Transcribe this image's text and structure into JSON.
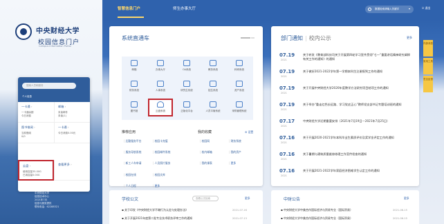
{
  "header": {
    "nav": [
      "智慧信息门户",
      "师生办事大厅"
    ],
    "search_placeholder": "数据检索请输入关键字",
    "logout": "退出"
  },
  "left": {
    "university_name": "中央财经大学",
    "portal_name": "校园信息门户",
    "portal_en": "Campus Information Portal",
    "search_placeholder": "搜索人员和服务",
    "personal_info": "个人信息",
    "cells": [
      {
        "title": "一卡通",
        "lines": [
          "一卡通余额",
          "今日消费"
        ]
      },
      {
        "title": "邮箱",
        "lines": [
          "未读邮件",
          "未读(1)"
        ]
      },
      {
        "title": "图书借阅",
        "lines": [
          "当前借阅",
          "0/0"
        ]
      },
      {
        "title": "一卡通",
        "lines": [
          "今日消费0.00元"
        ]
      },
      {
        "title": "云盘",
        "lines": [
          "使用容量35.00G",
          "已用容量0.00G"
        ]
      },
      {
        "title": "查看更多",
        "lines": []
      }
    ],
    "footer": [
      "中央财经大学",
      "信息技术中心",
      "2021年7月",
      "信息与服务提供",
      "联系电话：62288321"
    ]
  },
  "system": {
    "title": "系统直通车",
    "tiles": [
      [
        "邮箱",
        "办事大厅",
        "OA系统",
        "教务系统",
        "科研系统"
      ],
      [
        "财务系统",
        "人事系统",
        "研究生系统",
        "招生系统",
        "资产系统"
      ],
      [
        "图书馆",
        "云盘系统",
        "正版化平台",
        "人员平衡系统",
        "采购管理系统"
      ]
    ],
    "recommend_title": "推荐应用",
    "recommend_items": [
      "后勤服务平台",
      "校园卡充值",
      "服务导航系统",
      "校园邮件系统",
      "新工人车申请",
      "人员照片服务",
      "校园在线",
      "校园文库",
      "个人日程",
      "更多"
    ],
    "favorites_title": "我的收藏",
    "favorites_action": "设置",
    "favorites_items": [
      "校园网",
      "财务系统",
      "校内邮箱",
      "我的资产",
      "我的课表",
      "更多"
    ]
  },
  "notice": {
    "title_a": "部门通知",
    "title_b": "校内公示",
    "more": "更多",
    "items": [
      {
        "date": "07.19",
        "year": "2021",
        "text": "关于转发《教育部科技司关于开展第四轮学习宣传贯彻“七一”重要讲话精神研究阐释有关工作的通知》的通知"
      },
      {
        "date": "07.19",
        "year": "2021",
        "text": "关于做好2021-2022学年第一学期本科生注册报到工作的通知"
      },
      {
        "date": "07.19",
        "year": "2021",
        "text": "关于开展中央财经大学2020年度教学方法研究项目结项工作的通知"
      },
      {
        "date": "07.19",
        "year": "2021",
        "text": "关于举办“重走红色长征路、学习党史正心”教师党支部书记专题培训班的通知"
      },
      {
        "date": "07.17",
        "year": "2021",
        "text": "中央财经大学近期重要安排（2021年7月19日—2021年7月25日）"
      },
      {
        "date": "07.16",
        "year": "2021",
        "text": "关于开展2020-2021学年本科毕业生素质评价及奖学金评定工作的通知"
      },
      {
        "date": "07.16",
        "year": "2021",
        "text": "关于暑期与建筑质量维修修理工作宣传检查的通知"
      },
      {
        "date": "07.16",
        "year": "2021",
        "text": "关于开展2021-2022学年家庭经济困难学生认定工作的通知"
      }
    ]
  },
  "side_tabs": [
    "内部消息",
    "常用工具",
    "意见反馈"
  ],
  "bottom": {
    "left_title": "学校公文",
    "left_search": "查看公文检索",
    "left_more": "更多",
    "left_rows": [
      {
        "text": "关于印发《中央财经大学不端行为认定与处理办法》",
        "date": "2021-07-16"
      },
      {
        "text": "关于开展2021年度第二批专业技术职务评审工作的通知",
        "date": "2021-07-13"
      }
    ],
    "right_title": "中财公告",
    "right_more": "更多",
    "right_rows": [
      {
        "text": "中央财经大学中美合作国际经济与贸易专业（国际贸易）",
        "date": "2021-06-15"
      },
      {
        "text": "中央财经大学中美合作国际经济与贸易专业（国际贸易）",
        "date": "2021-06-15"
      }
    ]
  }
}
